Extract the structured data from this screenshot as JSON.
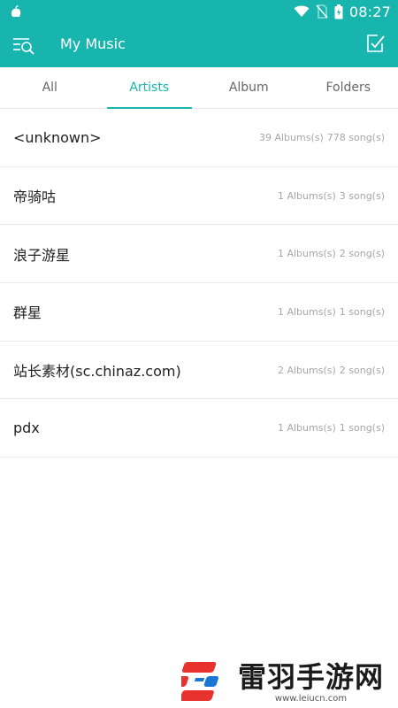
{
  "status_bar": {
    "time": "08:27",
    "icons": [
      "app-notification-icon",
      "wifi-icon",
      "no-sim-icon",
      "battery-icon"
    ]
  },
  "app_bar": {
    "title": "My Music",
    "left_icon": "menu-search-icon",
    "right_icon": "edit-select-icon"
  },
  "tabs": [
    {
      "label": "All",
      "active": false
    },
    {
      "label": "Artists",
      "active": true
    },
    {
      "label": "Album",
      "active": false
    },
    {
      "label": "Folders",
      "active": false
    }
  ],
  "artists": [
    {
      "name": "<unknown>",
      "albums": "39 Albums(s)",
      "songs": "778 song(s)"
    },
    {
      "name": "帝骑咕",
      "albums": "1 Albums(s)",
      "songs": "3 song(s)"
    },
    {
      "name": "浪子游星",
      "albums": "1 Albums(s)",
      "songs": "2 song(s)"
    },
    {
      "name": "群星",
      "albums": "1 Albums(s)",
      "songs": "1 song(s)"
    },
    {
      "name": "站长素材(sc.chinaz.com)",
      "albums": "2 Albums(s)",
      "songs": "2 song(s)"
    },
    {
      "name": "pdx",
      "albums": "1 Albums(s)",
      "songs": "1 song(s)"
    }
  ],
  "watermark": {
    "name": "雷羽手游网",
    "url": "www.leiucn.com"
  },
  "colors": {
    "accent": "#17b5ae",
    "text_primary": "#222222",
    "text_secondary": "#a6a6a6",
    "tab_inactive": "#666666"
  }
}
